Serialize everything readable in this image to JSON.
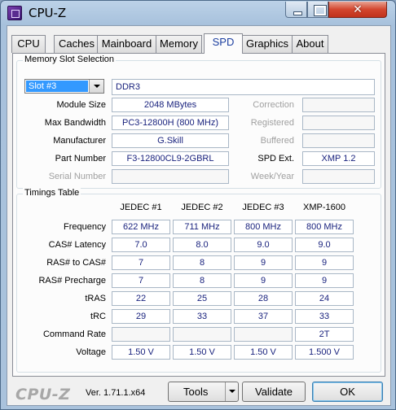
{
  "window": {
    "title": "CPU-Z"
  },
  "tabs": [
    {
      "label": "CPU",
      "active": false
    },
    {
      "label": "Caches",
      "active": false
    },
    {
      "label": "Mainboard",
      "active": false
    },
    {
      "label": "Memory",
      "active": false
    },
    {
      "label": "SPD",
      "active": true
    },
    {
      "label": "Graphics",
      "active": false
    },
    {
      "label": "About",
      "active": false
    }
  ],
  "slot": {
    "group_title": "Memory Slot Selection",
    "selected": "Slot #3",
    "type": "DDR3",
    "left_fields": [
      {
        "label": "Module Size",
        "value": "2048 MBytes",
        "enabled": true
      },
      {
        "label": "Max Bandwidth",
        "value": "PC3-12800H (800 MHz)",
        "enabled": true
      },
      {
        "label": "Manufacturer",
        "value": "G.Skill",
        "enabled": true
      },
      {
        "label": "Part Number",
        "value": "F3-12800CL9-2GBRL",
        "enabled": true
      },
      {
        "label": "Serial Number",
        "value": "",
        "enabled": false
      }
    ],
    "right_fields": [
      {
        "label": "Correction",
        "value": "",
        "enabled": false
      },
      {
        "label": "Registered",
        "value": "",
        "enabled": false
      },
      {
        "label": "Buffered",
        "value": "",
        "enabled": false
      },
      {
        "label": "SPD Ext.",
        "value": "XMP 1.2",
        "enabled": true
      },
      {
        "label": "Week/Year",
        "value": "",
        "enabled": false
      }
    ]
  },
  "timings": {
    "group_title": "Timings Table",
    "columns": [
      "JEDEC #1",
      "JEDEC #2",
      "JEDEC #3",
      "XMP-1600"
    ],
    "rows": [
      {
        "label": "Frequency",
        "values": [
          "622 MHz",
          "711 MHz",
          "800 MHz",
          "800 MHz"
        ]
      },
      {
        "label": "CAS# Latency",
        "values": [
          "7.0",
          "8.0",
          "9.0",
          "9.0"
        ]
      },
      {
        "label": "RAS# to CAS#",
        "values": [
          "7",
          "8",
          "9",
          "9"
        ]
      },
      {
        "label": "RAS# Precharge",
        "values": [
          "7",
          "8",
          "9",
          "9"
        ]
      },
      {
        "label": "tRAS",
        "values": [
          "22",
          "25",
          "28",
          "24"
        ]
      },
      {
        "label": "tRC",
        "values": [
          "29",
          "33",
          "37",
          "33"
        ]
      },
      {
        "label": "Command Rate",
        "values": [
          "",
          "",
          "",
          "2T"
        ]
      },
      {
        "label": "Voltage",
        "values": [
          "1.50 V",
          "1.50 V",
          "1.50 V",
          "1.500 V"
        ]
      }
    ]
  },
  "footer": {
    "logo": "CPU-Z",
    "version": "Ver. 1.71.1.x64",
    "tools_label": "Tools",
    "validate_label": "Validate",
    "ok_label": "OK"
  }
}
